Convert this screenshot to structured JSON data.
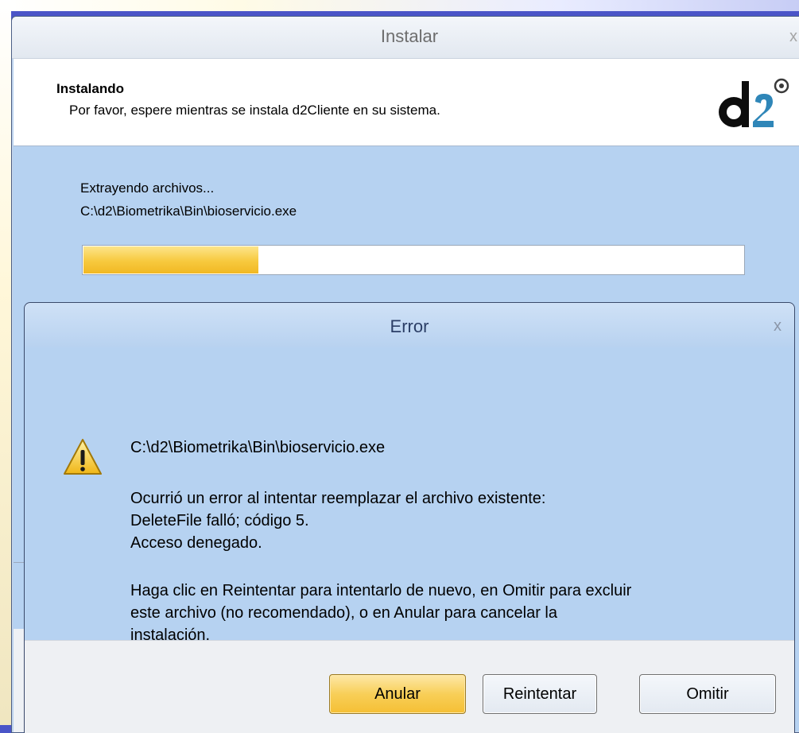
{
  "installer": {
    "title": "Instalar",
    "close_glyph": "x",
    "header_title": "Instalando",
    "header_subtitle": "Por favor, espere mientras se instala d2Cliente en su sistema.",
    "logo_icon": "d2-logo-icon",
    "status": "Extrayendo archivos...",
    "current_file": "C:\\d2\\Biometrika\\Bin\\bioservicio.exe",
    "progress": 0.265,
    "progress_color": "#f7c93e"
  },
  "error_dialog": {
    "title": "Error",
    "close_glyph": "x",
    "icon": "warning-icon",
    "file_path": "C:\\d2\\Biometrika\\Bin\\bioservicio.exe",
    "message_lines": [
      "Ocurrió un error al intentar reemplazar el archivo existente:",
      "DeleteFile falló; código 5.",
      "Acceso denegado."
    ],
    "instructions_lines": [
      "Haga clic en Reintentar para intentarlo de nuevo, en Omitir para excluir",
      "este archivo (no recomendado), o en Anular para cancelar la",
      "instalación."
    ],
    "buttons": {
      "abort": "Anular",
      "retry": "Reintentar",
      "ignore": "Omitir"
    }
  },
  "colors": {
    "dialog_body": "#b6d2f1",
    "title_text": "#2b3e66",
    "default_button": "#f5bf34"
  }
}
